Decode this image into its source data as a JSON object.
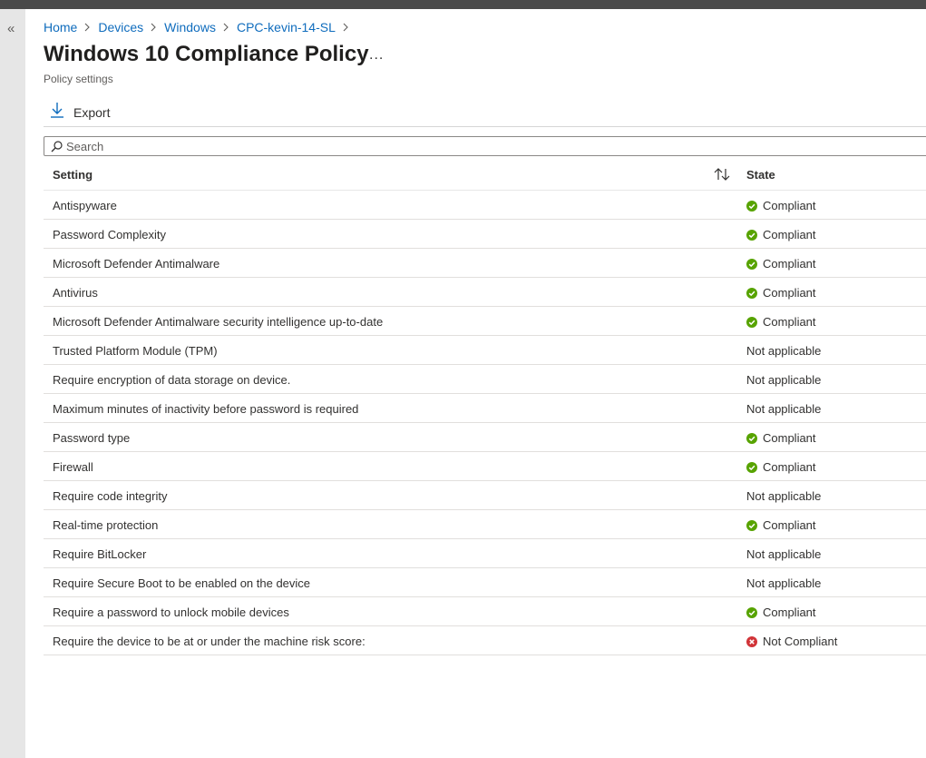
{
  "breadcrumb": [
    "Home",
    "Devices",
    "Windows",
    "CPC-kevin-14-SL"
  ],
  "header": {
    "title": "Windows 10 Compliance Policy",
    "more_label": "...",
    "subtitle": "Policy settings"
  },
  "toolbar": {
    "export_label": "Export"
  },
  "search": {
    "placeholder": "Search",
    "value": ""
  },
  "table": {
    "columns": {
      "setting": "Setting",
      "state": "State"
    },
    "rows": [
      {
        "setting": "Antispyware",
        "state": "Compliant",
        "status": "compliant"
      },
      {
        "setting": "Password Complexity",
        "state": "Compliant",
        "status": "compliant"
      },
      {
        "setting": "Microsoft Defender Antimalware",
        "state": "Compliant",
        "status": "compliant"
      },
      {
        "setting": "Antivirus",
        "state": "Compliant",
        "status": "compliant"
      },
      {
        "setting": "Microsoft Defender Antimalware security intelligence up-to-date",
        "state": "Compliant",
        "status": "compliant"
      },
      {
        "setting": "Trusted Platform Module (TPM)",
        "state": "Not applicable",
        "status": "na"
      },
      {
        "setting": "Require encryption of data storage on device.",
        "state": "Not applicable",
        "status": "na"
      },
      {
        "setting": "Maximum minutes of inactivity before password is required",
        "state": "Not applicable",
        "status": "na"
      },
      {
        "setting": "Password type",
        "state": "Compliant",
        "status": "compliant"
      },
      {
        "setting": "Firewall",
        "state": "Compliant",
        "status": "compliant"
      },
      {
        "setting": "Require code integrity",
        "state": "Not applicable",
        "status": "na"
      },
      {
        "setting": "Real-time protection",
        "state": "Compliant",
        "status": "compliant"
      },
      {
        "setting": "Require BitLocker",
        "state": "Not applicable",
        "status": "na"
      },
      {
        "setting": "Require Secure Boot to be enabled on the device",
        "state": "Not applicable",
        "status": "na"
      },
      {
        "setting": "Require a password to unlock mobile devices",
        "state": "Compliant",
        "status": "compliant"
      },
      {
        "setting": "Require the device to be at or under the machine risk score:",
        "state": "Not Compliant",
        "status": "noncompliant"
      }
    ]
  },
  "icons": {
    "collapse": "double-chevron-left-icon",
    "export": "download-icon",
    "search": "search-icon",
    "sort": "sort-icon",
    "compliant": "check-circle-icon",
    "noncompliant": "error-circle-icon"
  },
  "colors": {
    "link": "#0f6cbd",
    "compliant": "#57a300",
    "noncompliant": "#d13438",
    "topbar": "#4a4a4a",
    "rail": "#e6e6e6"
  }
}
